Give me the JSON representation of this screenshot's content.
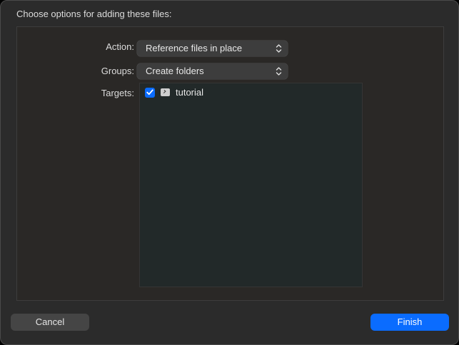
{
  "dialog": {
    "title": "Choose options for adding these files:"
  },
  "options": {
    "action": {
      "label": "Action:",
      "selected": "Reference files in place"
    },
    "groups": {
      "label": "Groups:",
      "selected": "Create folders"
    },
    "targets": {
      "label": "Targets:",
      "items": [
        {
          "name": "tutorial",
          "checked": true,
          "icon": "terminal-app-icon"
        }
      ]
    }
  },
  "buttons": {
    "cancel": "Cancel",
    "finish": "Finish"
  },
  "colors": {
    "accent": "#0a6cff",
    "dialog_background": "#2b2b2b",
    "panel_background": "#2a2826",
    "list_background": "#222929"
  }
}
